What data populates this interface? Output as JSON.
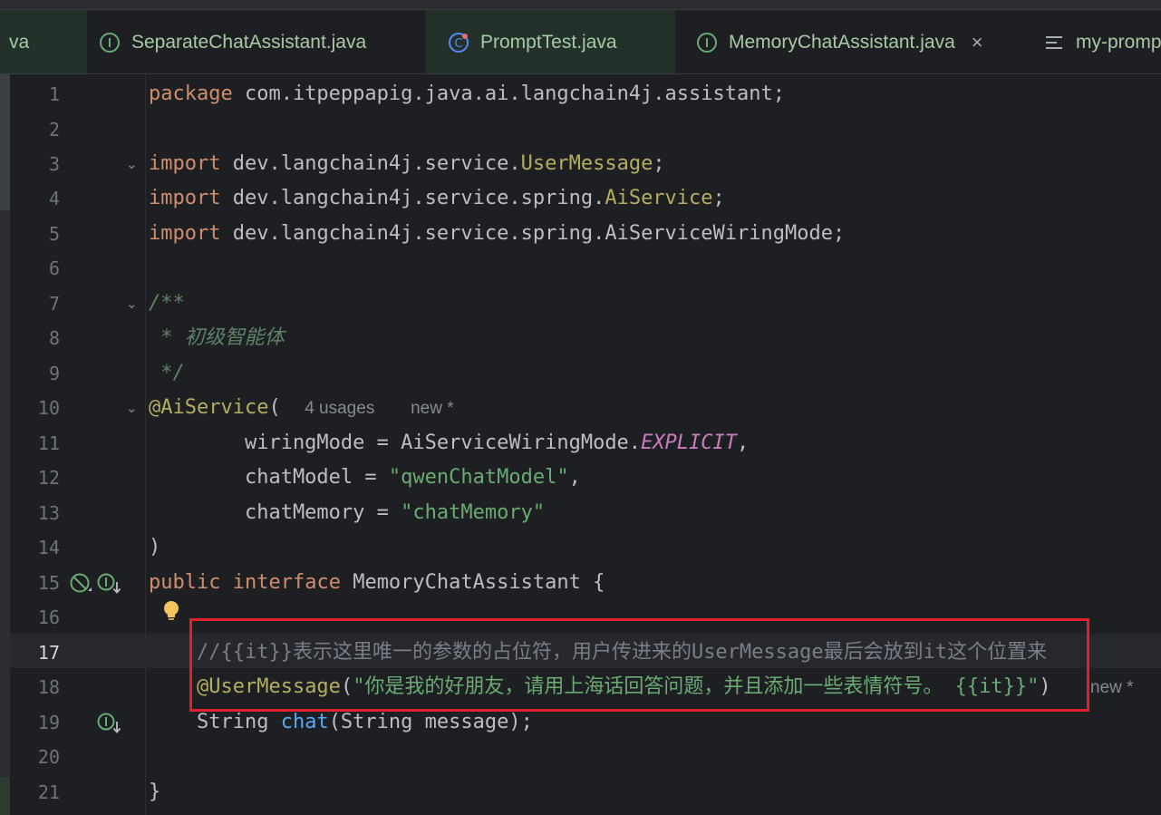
{
  "tabs": [
    {
      "label": "va",
      "icon": "none",
      "active": false
    },
    {
      "label": "SeparateChatAssistant.java",
      "icon": "interface-icon",
      "active": false
    },
    {
      "label": "PromptTest.java",
      "icon": "test-class-icon",
      "active": false
    },
    {
      "label": "MemoryChatAssistant.java",
      "icon": "interface-icon",
      "active": true,
      "close": "×"
    },
    {
      "label": "my-promp",
      "icon": "text-file-icon",
      "active": false
    }
  ],
  "lines": [
    {
      "n": "1"
    },
    {
      "n": "2"
    },
    {
      "n": "3"
    },
    {
      "n": "4"
    },
    {
      "n": "5"
    },
    {
      "n": "6"
    },
    {
      "n": "7"
    },
    {
      "n": "8"
    },
    {
      "n": "9"
    },
    {
      "n": "10"
    },
    {
      "n": "11"
    },
    {
      "n": "12"
    },
    {
      "n": "13"
    },
    {
      "n": "14"
    },
    {
      "n": "15"
    },
    {
      "n": "16"
    },
    {
      "n": "17"
    },
    {
      "n": "18"
    },
    {
      "n": "19"
    },
    {
      "n": "20"
    },
    {
      "n": "21"
    }
  ],
  "code": {
    "l1": {
      "kw": "package",
      "rest": " com.itpeppapig.java.ai.langchain4j.assistant;"
    },
    "l3": {
      "kw": "import",
      "pre": " dev.langchain4j.service.",
      "cls": "UserMessage",
      "end": ";"
    },
    "l4": {
      "kw": "import",
      "pre": " dev.langchain4j.service.spring.",
      "cls": "AiService",
      "end": ";"
    },
    "l5": {
      "kw": "import",
      "rest": " dev.langchain4j.service.spring.AiServiceWiringMode;"
    },
    "l7": {
      "doc": "/**"
    },
    "l8": {
      "doc": " * 初级智能体"
    },
    "l9": {
      "doc": " */"
    },
    "l10": {
      "ann": "@AiService",
      "paren": "(",
      "usages": "4 usages",
      "newhint": "new *"
    },
    "l11": {
      "pre": "        wiringMode = AiServiceWiringMode.",
      "cst": "EXPLICIT",
      "end": ","
    },
    "l12": {
      "pre": "        chatModel = ",
      "str": "\"qwenChatModel\"",
      "end": ","
    },
    "l13": {
      "pre": "        chatMemory = ",
      "str": "\"chatMemory\""
    },
    "l14": {
      "text": ")"
    },
    "l15": {
      "kw1": "public",
      "kw2": "interface",
      "rest": " MemoryChatAssistant {"
    },
    "l17": {
      "indent": "    ",
      "cmt": "//{{it}}表示这里唯一的参数的占位符，用户传进来的UserMessage最后会放到it这个位置来"
    },
    "l18": {
      "indent": "    ",
      "ann": "@UserMessage",
      "open": "(",
      "str": "\"你是我的好朋友，请用上海话回答问题，并且添加一些表情符号。 {{it}}\"",
      "close": ")",
      "newhint": "new *"
    },
    "l19": {
      "indent": "    ",
      "pre": "String ",
      "fn": "chat",
      "rest": "(String message);"
    },
    "l21": {
      "text": "}"
    }
  },
  "colors": {
    "background": "#1e1f22",
    "keyword": "#cf8e6d",
    "annotation": "#b3ae60",
    "string": "#6aab73",
    "comment": "#7a7e85",
    "doc": "#5f826b",
    "highlight_box": "#e0202c"
  }
}
